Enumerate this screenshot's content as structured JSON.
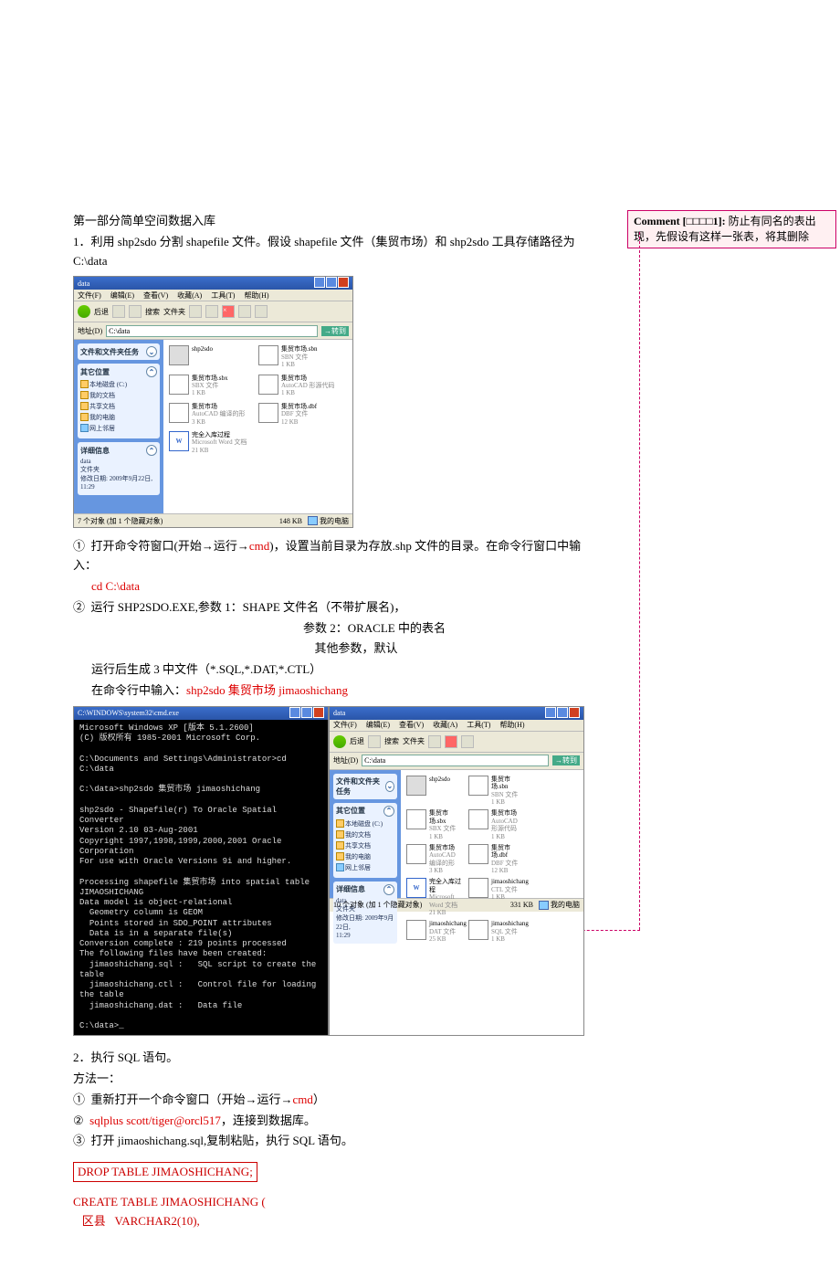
{
  "heading": "第一部分简单空间数据入库",
  "step1": {
    "num": "1．",
    "textA": "利用 shp2sdo 分割 shapefile 文件。假设 shapefile 文件（集贸市场）和 shp2sdo 工具存储路径为 C:\\data"
  },
  "explorer1": {
    "title": "data",
    "menus": [
      "文件(F)",
      "编辑(E)",
      "查看(V)",
      "收藏(A)",
      "工具(T)",
      "帮助(H)"
    ],
    "addr_label": "地址(D)",
    "addr_value": "C:\\data",
    "go": "转到",
    "side_tasks": "文件和文件夹任务",
    "side_other": "其它位置",
    "other_items": [
      "本地磁盘 (C:)",
      "我的文档",
      "共享文档",
      "我的电脑",
      "网上邻居"
    ],
    "side_detail": "详细信息",
    "detail_text": "data\n文件夹\n修改日期: 2009年9月22日,\n11:29",
    "files": [
      {
        "name": "shp2sdo",
        "meta": "",
        "icon": "exe"
      },
      {
        "name": "集贸市场.sbn",
        "meta": "SBN 文件\n1 KB",
        "icon": "txt"
      },
      {
        "name": "集贸市场.sbx",
        "meta": "SBX 文件\n1 KB",
        "icon": "txt"
      },
      {
        "name": "集贸市场",
        "meta": "AutoCAD 形源代码\n1 KB",
        "icon": "txt"
      },
      {
        "name": "集贸市场",
        "meta": "AutoCAD 编译的形\n3 KB",
        "icon": "txt"
      },
      {
        "name": "集贸市场.dbf",
        "meta": "DBF 文件\n12 KB",
        "icon": "txt"
      },
      {
        "name": "完全入库过程",
        "meta": "Microsoft Word 文档\n21 KB",
        "icon": "word"
      }
    ],
    "status_left": "7 个对象 (加 1 个隐藏对象)",
    "status_size": "148 KB",
    "status_right": "我的电脑"
  },
  "step1_1": {
    "mark": "①",
    "a": "打开命令符窗口(开始→运行→",
    "cmd": "cmd",
    "b": ")，设置当前目录为存放.shp 文件的目录。在命令行窗口中输入：",
    "cd": "cd C:\\data"
  },
  "step1_2": {
    "mark": "②",
    "a": "运行 SHP2SDO.EXE,参数 1：SHAPE 文件名（不带扩展名)，",
    "b": "参数 2：ORACLE 中的表名",
    "c": "其他参数，默认",
    "d": "运行后生成 3 中文件（*.SQL,*.DAT,*.CTL）",
    "e": "在命令行中输入：",
    "input": "shp2sdo 集贸市场 jimaoshichang"
  },
  "cmd_window": {
    "title": "C:\\WINDOWS\\system32\\cmd.exe",
    "body": "Microsoft Windows XP [版本 5.1.2600]\n(C) 版权所有 1985-2001 Microsoft Corp.\n\nC:\\Documents and Settings\\Administrator>cd C:\\data\n\nC:\\data>shp2sdo 集贸市场 jimaoshichang\n\nshp2sdo - Shapefile(r) To Oracle Spatial Converter\nVersion 2.10 03-Aug-2001\nCopyright 1997,1998,1999,2000,2001 Oracle Corporation\nFor use with Oracle Versions 9i and higher.\n\nProcessing shapefile 集贸市场 into spatial table JIMAOSHICHANG\nData model is object-relational\n  Geometry column is GEOM\n  Points stored in SDO_POINT attributes\n  Data is in a separate file(s)\nConversion complete : 219 points processed\nThe following files have been created:\n  jimaoshichang.sql :   SQL script to create the table\n  jimaoshichang.ctl :   Control file for loading the table\n  jimaoshichang.dat :   Data file\n\nC:\\data>_"
  },
  "explorer2": {
    "title": "data",
    "files_extra": [
      {
        "name": "jimaoshichang",
        "meta": "CTL 文件\n1 KB",
        "icon": "txt"
      },
      {
        "name": "jimaoshichang",
        "meta": "DAT 文件\n25 KB",
        "icon": "txt"
      },
      {
        "name": "jimaoshichang",
        "meta": "SQL 文件\n1 KB",
        "icon": "txt"
      }
    ],
    "status_left": "10 个对象 (加 1 个隐藏对象)",
    "status_size": "331 KB"
  },
  "step2": {
    "num": "2．",
    "a": "执行 SQL 语句。",
    "b": "方法一：",
    "c_mark": "①",
    "c": "重新打开一个命令窗口（开始→运行→",
    "c_cmd": "cmd",
    "c_end": "）",
    "d_mark": "②",
    "d_red": "sqlplus scott/tiger@orcl517",
    "d_end": "，连接到数据库。",
    "e_mark": "③",
    "e": "打开 jimaoshichang.sql,复制粘贴，执行 SQL 语句。"
  },
  "sql_drop": "DROP TABLE JIMAOSHICHANG;",
  "sql_create": "CREATE TABLE JIMAOSHICHANG (\n   区县   VARCHAR2(10),",
  "comment": {
    "label": "Comment [□□□□1]: ",
    "text": "防止有同名的表出现，先假设有这样一张表，将其删除"
  }
}
